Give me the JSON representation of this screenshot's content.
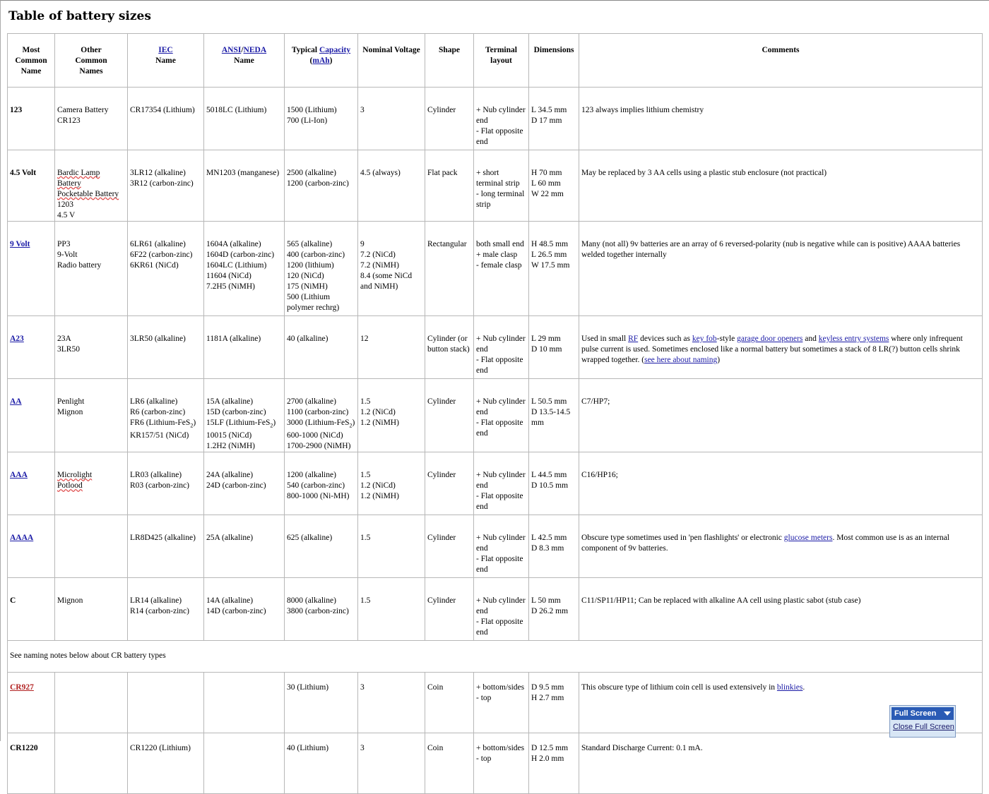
{
  "title": "Table of battery sizes",
  "headers": {
    "most_common": [
      "Most",
      "Common",
      "Name"
    ],
    "other_common": [
      "Other",
      "Common",
      "Names"
    ],
    "iec_link": "IEC",
    "iec_sub": "Name",
    "ansi_link": "ANSI",
    "slash": "/",
    "neda_link": "NEDA",
    "ansi_sub": "Name",
    "typical": "Typical",
    "capacity_link": "Capacity",
    "mah_open": "(",
    "mah_link": "mAh",
    "mah_close": ")",
    "voltage": "Nominal Voltage",
    "shape": "Shape",
    "terminal": [
      "Terminal",
      "layout"
    ],
    "dimensions": "Dimensions",
    "comments": "Comments"
  },
  "rows": {
    "r123": {
      "name": "123",
      "other": [
        "Camera Battery",
        "CR123"
      ],
      "iec": [
        "CR17354 (Lithium)"
      ],
      "ansi": [
        "5018LC (Lithium)"
      ],
      "capacity": [
        "1500 (Lithium)",
        "700 (Li-Ion)"
      ],
      "voltage": [
        "3"
      ],
      "shape": [
        "Cylinder"
      ],
      "terminal": [
        "+ Nub cylinder end",
        "- Flat opposite end"
      ],
      "dims": [
        "L 34.5 mm",
        "D 17 mm"
      ],
      "comments": "123 always implies lithium chemistry"
    },
    "r45": {
      "name": "4.5 Volt",
      "other": [
        "Bardic Lamp Battery",
        "Pocketable Battery",
        "1203",
        "4.5 V"
      ],
      "iec": [
        "3LR12 (alkaline)",
        "3R12 (carbon-zinc)"
      ],
      "ansi": [
        "MN1203 (manganese)"
      ],
      "capacity": [
        "2500 (alkaline)",
        "1200 (carbon-zinc)"
      ],
      "voltage": [
        "4.5 (always)"
      ],
      "shape": [
        "Flat pack"
      ],
      "terminal": [
        "+ short terminal strip",
        "- long terminal strip"
      ],
      "dims": [
        "H 70 mm",
        "L 60 mm",
        "W 22 mm"
      ],
      "comments": "May be replaced by 3 AA cells using a plastic stub enclosure (not practical)"
    },
    "r9v": {
      "name": "9 Volt",
      "other": [
        "PP3",
        "9-Volt",
        "Radio battery"
      ],
      "iec": [
        "6LR61 (alkaline)",
        "6F22 (carbon-zinc)",
        "6KR61 (NiCd)"
      ],
      "ansi": [
        "1604A (alkaline)",
        "1604D (carbon-zinc)",
        "1604LC (Lithium)",
        "11604 (NiCd)",
        "7.2H5 (NiMH)"
      ],
      "capacity": [
        "565 (alkaline)",
        "400 (carbon-zinc)",
        "1200 (lithium)",
        "120 (NiCd)",
        "175 (NiMH)",
        "500 (Lithium polymer rechrg)"
      ],
      "voltage": [
        "9",
        "7.2 (NiCd)",
        "7.2 (NiMH)",
        "8.4 (some NiCd and NiMH)"
      ],
      "shape": [
        "Rectangular"
      ],
      "terminal": [
        "both small end",
        "+ male clasp",
        "- female clasp"
      ],
      "dims": [
        "H 48.5 mm",
        "L 26.5 mm",
        "W 17.5 mm"
      ],
      "comments": "Many (not all) 9v batteries are an array of 6 reversed-polarity (nub is negative while can is positive) AAAA batteries welded together internally"
    },
    "ra23": {
      "name": "A23",
      "other": [
        "23A",
        "3LR50"
      ],
      "iec": [
        "3LR50 (alkaline)"
      ],
      "ansi": [
        "1181A (alkaline)"
      ],
      "capacity": [
        "40 (alkaline)"
      ],
      "voltage": [
        "12"
      ],
      "shape": [
        "Cylinder (or button stack)"
      ],
      "terminal": [
        "+ Nub cylinder end",
        "- Flat opposite end"
      ],
      "dims": [
        "L 29 mm",
        "D 10 mm"
      ],
      "c1": "Used in small ",
      "c_rf": "RF",
      "c2": " devices such as ",
      "c_keyfob": "key fob",
      "c3": "-style ",
      "c_garage": "garage door openers",
      "c4": " and ",
      "c_keyless": "keyless entry systems",
      "c5": " where only infrequent pulse current is used. Sometimes enclosed like a normal battery but sometimes a stack of 8 LR(?) button cells shrink wrapped together. (",
      "c_naming": "see here about naming",
      "c6": ")"
    },
    "raa": {
      "name": "AA",
      "other": [
        "Penlight",
        "Mignon"
      ],
      "iec": [
        "LR6 (alkaline)",
        "R6 (carbon-zinc)",
        "FR6 (Lithium-FeS2)",
        "KR157/51 (NiCd)"
      ],
      "ansi": [
        "15A (alkaline)",
        "15D (carbon-zinc)",
        "15LF (Lithium-FeS2)",
        "10015 (NiCd)",
        "1.2H2 (NiMH)"
      ],
      "capacity": [
        "2700 (alkaline)",
        "1100 (carbon-zinc)",
        "3000 (Lithium-FeS2)",
        "600-1000 (NiCd)",
        "1700-2900 (NiMH)"
      ],
      "voltage": [
        "1.5",
        "1.2 (NiCd)",
        "1.2 (NiMH)"
      ],
      "shape": [
        "Cylinder"
      ],
      "terminal": [
        "+ Nub cylinder end",
        "- Flat opposite end"
      ],
      "dims": [
        "L 50.5 mm",
        "D 13.5-14.5 mm"
      ],
      "comments": "C7/HP7;"
    },
    "raaa": {
      "name": "AAA",
      "other": [
        "Microlight",
        "Potlood"
      ],
      "iec": [
        "LR03 (alkaline)",
        "R03 (carbon-zinc)"
      ],
      "ansi": [
        "24A (alkaline)",
        "24D (carbon-zinc)"
      ],
      "capacity": [
        "1200 (alkaline)",
        "540 (carbon-zinc)",
        "800-1000 (Ni-MH)"
      ],
      "voltage": [
        "1.5",
        "1.2 (NiCd)",
        "1.2 (NiMH)"
      ],
      "shape": [
        "Cylinder"
      ],
      "terminal": [
        "+ Nub cylinder end",
        "- Flat opposite end"
      ],
      "dims": [
        "L 44.5 mm",
        "D 10.5 mm"
      ],
      "comments": "C16/HP16;"
    },
    "raaaa": {
      "name": "AAAA",
      "other": [],
      "iec": [
        "LR8D425 (alkaline)"
      ],
      "ansi": [
        "25A (alkaline)"
      ],
      "capacity": [
        "625 (alkaline)"
      ],
      "voltage": [
        "1.5"
      ],
      "shape": [
        "Cylinder"
      ],
      "terminal": [
        "+ Nub cylinder end",
        "- Flat opposite end"
      ],
      "dims": [
        "L 42.5 mm",
        "D 8.3 mm"
      ],
      "c1": "Obscure type sometimes used in 'pen flashlights' or electronic ",
      "c_glucose": "glucose meters",
      "c2": ". Most common use is as an internal component of 9v batteries."
    },
    "rc": {
      "name": "C",
      "other": [
        "Mignon"
      ],
      "iec": [
        "LR14 (alkaline)",
        "R14 (carbon-zinc)"
      ],
      "ansi": [
        "14A (alkaline)",
        "14D (carbon-zinc)"
      ],
      "capacity": [
        "8000 (alkaline)",
        "3800 (carbon-zinc)"
      ],
      "voltage": [
        "1.5"
      ],
      "shape": [
        "Cylinder"
      ],
      "terminal": [
        "+ Nub cylinder end",
        "- Flat opposite end"
      ],
      "dims": [
        "L 50 mm",
        "D 26.2 mm"
      ],
      "comments": "C11/SP11/HP11; Can be replaced with alkaline AA cell using plastic sabot (stub case)"
    },
    "note": "See naming notes below about CR battery types",
    "rcr927": {
      "name": "CR927",
      "other": [],
      "iec": [],
      "ansi": [],
      "capacity": [
        "30 (Lithium)"
      ],
      "voltage": [
        "3"
      ],
      "shape": [
        "Coin"
      ],
      "terminal": [
        "+ bottom/sides",
        "- top"
      ],
      "dims": [
        "D 9.5 mm",
        "H 2.7 mm"
      ],
      "c1": "This obscure type of lithium coin cell is used extensively in ",
      "c_blinkies": "blinkies",
      "c2": "."
    },
    "rcr1220": {
      "name": "CR1220",
      "other": [],
      "iec": [
        "CR1220 (Lithium)"
      ],
      "ansi": [],
      "capacity": [
        "40 (Lithium)"
      ],
      "voltage": [
        "3"
      ],
      "shape": [
        "Coin"
      ],
      "terminal": [
        "+ bottom/sides",
        "- top"
      ],
      "dims": [
        "D 12.5 mm",
        "H 2.0 mm"
      ],
      "comments": "Standard Discharge Current: 0.1 mA."
    }
  },
  "fullscreen": {
    "label": "Full Screen",
    "close": "Close Full Screen"
  }
}
